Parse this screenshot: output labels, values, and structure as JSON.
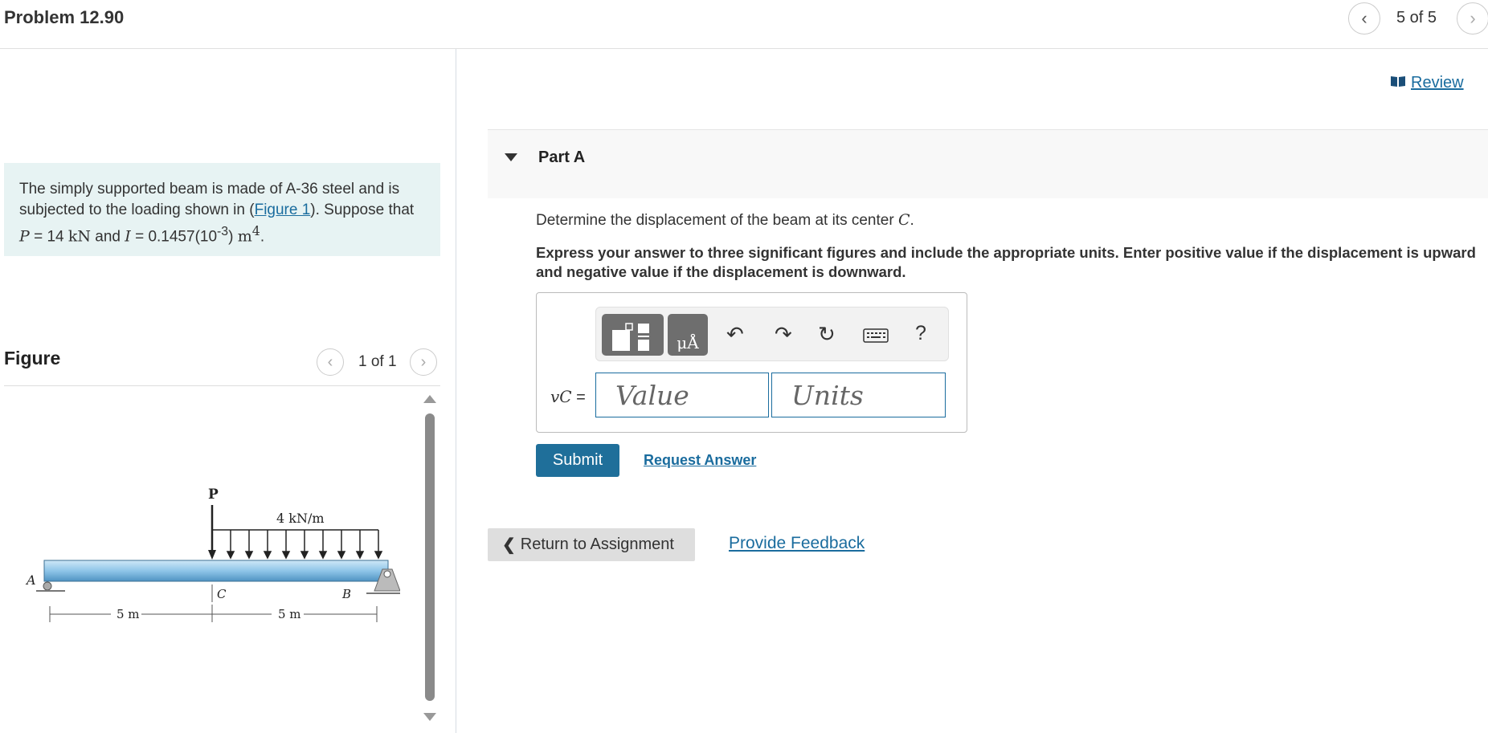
{
  "header": {
    "problem_title": "Problem 12.90",
    "pager_text": "5 of 5"
  },
  "intro": {
    "text_before_link": "The simply supported beam is made of A-36 steel and is subjected to the loading shown in (",
    "figure_link": "Figure 1",
    "text_after_link": "). Suppose that ",
    "P_symbol": "P",
    "P_value": " = 14 ",
    "P_unit": "kN",
    "and_text": " and ",
    "I_symbol": "I",
    "I_value": " = 0.1457(10",
    "I_exp": "-3",
    "I_close": ") ",
    "I_unit": "m",
    "I_unit_exp": "4",
    "end": "."
  },
  "figure": {
    "label": "Figure",
    "pager_text": "1 of 1",
    "load_P": "P",
    "load_w": "4 kN/m",
    "point_A": "A",
    "point_B": "B",
    "point_C": "C",
    "dim_left": "5 m",
    "dim_right": "5 m"
  },
  "right": {
    "review_label": "Review",
    "part_title": "Part A",
    "question_text": "Determine the displacement of the beam at its center ",
    "question_symbol": "C",
    "question_end": ".",
    "instructions": "Express your answer to three significant figures and include the appropriate units. Enter positive value if the displacement is upward and negative value if the displacement is downward.",
    "units_glyph": "μÅ",
    "help_glyph": "?",
    "var_symbol": "vC",
    "equals": " =",
    "value_placeholder": "Value",
    "units_placeholder": "Units",
    "submit_label": "Submit",
    "request_answer_label": "Request Answer",
    "return_label": "Return to Assignment",
    "feedback_label": "Provide Feedback"
  },
  "colors": {
    "accent": "#1f6f9a",
    "link": "#1a6c9e",
    "intro_bg": "#e7f3f3",
    "beam": "#8fc5e8"
  }
}
